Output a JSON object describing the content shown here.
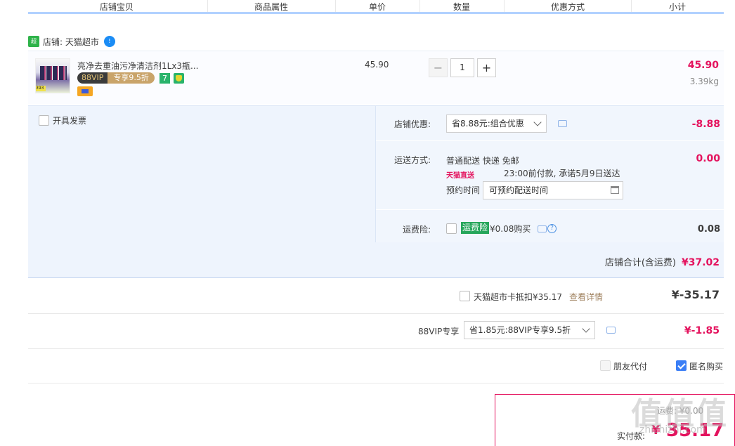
{
  "header": {
    "columns": [
      "店铺宝贝",
      "商品属性",
      "单价",
      "数量",
      "优惠方式",
      "小计"
    ]
  },
  "shop": {
    "title": "店铺: 天猫超市"
  },
  "item": {
    "title": "亮净去重油污净清洁剂1Lx3瓶...",
    "vip_left": "88VIP",
    "vip_right": "专享9.5折",
    "seven_label": "7",
    "unit_price": "45.90",
    "minus": "−",
    "quantity": "1",
    "plus": "+",
    "subtotal": "45.90",
    "weight": "3.39kg"
  },
  "invoice": {
    "label": "开具发票"
  },
  "discount": {
    "label": "店铺优惠:",
    "selected": "省8.88元:组合优惠",
    "amount": "-8.88"
  },
  "shipping": {
    "label": "运送方式:",
    "method": "普通配送 快递 免邮",
    "tmall_tag": "天猫直送",
    "promise": "23:00前付款, 承诺5月9日送达",
    "appt_label": "预约时间",
    "appt_placeholder": "可预约配送时间",
    "amount": "0.00"
  },
  "insurance": {
    "label": "运费险:",
    "badge": "运费险",
    "text": "¥0.08购买",
    "amount": "0.08"
  },
  "shop_total": {
    "label": "店铺合计(含运费)",
    "value": "¥37.02"
  },
  "card": {
    "label": "天猫超市卡抵扣¥35.17",
    "link": "查看详情",
    "amount": "¥-35.17"
  },
  "vip88": {
    "label": "88VIP专享",
    "selected": "省1.85元:88VIP专享9.5折",
    "amount": "¥-1.85"
  },
  "options": {
    "friend_pay": "朋友代付",
    "anonymous": "匿名购买"
  },
  "payment": {
    "hint": "运费: ¥0.00",
    "label": "实付款:",
    "yen": "¥",
    "amount": "35.17"
  },
  "watermark": {
    "text": "值值值",
    "sub": "zhizhizhi.com"
  }
}
